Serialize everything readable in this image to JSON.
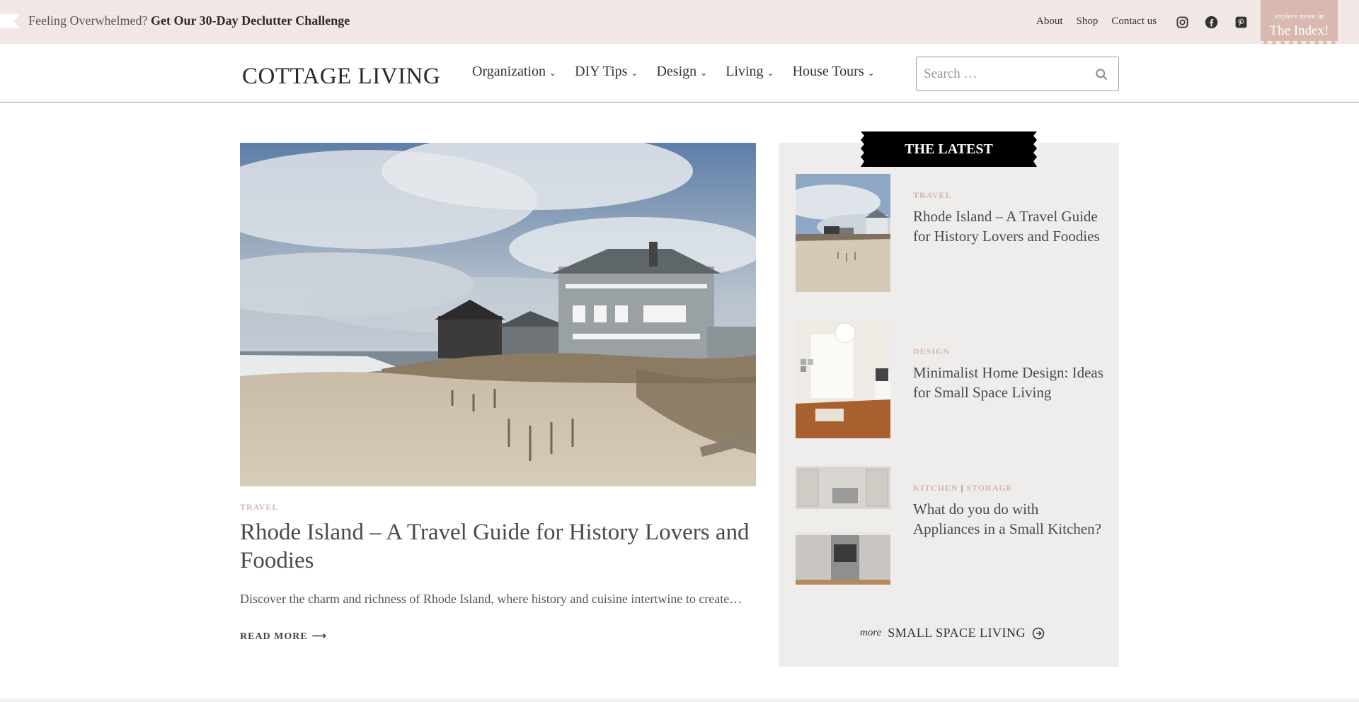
{
  "promo": {
    "lead": "Feeling Overwhelmed?",
    "cta": "Get Our 30-Day Declutter Challenge"
  },
  "top_links": [
    "About",
    "Shop",
    "Contact us"
  ],
  "social": [
    "instagram-icon",
    "facebook-icon",
    "pinterest-icon"
  ],
  "index_tab": {
    "small": "explore more in",
    "big": "The Index!"
  },
  "header": {
    "logo": "COTTAGE LIVING",
    "nav": [
      "Organization",
      "DIY Tips",
      "Design",
      "Living",
      "House Tours"
    ],
    "search_placeholder": "Search …"
  },
  "article": {
    "category": "TRAVEL",
    "title": "Rhode Island – A Travel Guide for History Lovers and Foodies",
    "excerpt": "Discover the charm and richness of Rhode Island, where history and cuisine intertwine to create…",
    "read_more": "READ MORE"
  },
  "sidebar": {
    "heading": "THE LATEST",
    "posts": [
      {
        "categories": [
          "TRAVEL"
        ],
        "title": "Rhode Island – A Travel Guide for History Lovers and Foodies"
      },
      {
        "categories": [
          "DESIGN"
        ],
        "title": "Minimalist Home Design: Ideas for Small Space Living"
      },
      {
        "categories": [
          "KITCHEN",
          "STORAGE"
        ],
        "title": "What do you do with Appliances in a Small Kitchen?"
      }
    ],
    "more_prefix": "more",
    "more_label": "SMALL SPACE LIVING"
  },
  "colors": {
    "accent_pink": "#d3b5ac",
    "topbar_bg": "#f1e8e5",
    "index_tab_bg": "#d9b8b0",
    "sidebar_bg": "#efedec"
  }
}
